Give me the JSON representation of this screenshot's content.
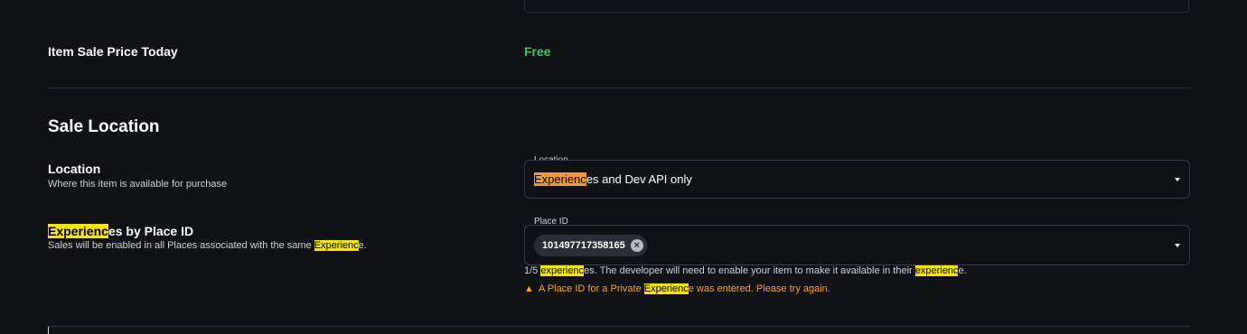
{
  "price": {
    "label": "Item Sale Price Today",
    "value": "Free"
  },
  "sale_location": {
    "title": "Sale Location",
    "location": {
      "label": "Location",
      "description": "Where this item is available for purchase",
      "field_caption": "Location",
      "selected_highlight": "Experienc",
      "selected_rest": "es and Dev API only"
    },
    "place_id": {
      "label_highlight": "Experienc",
      "label_rest": "es by Place ID",
      "description_pre": "Sales will be enabled in all Places associated with the same ",
      "description_highlight": "Experienc",
      "description_post": "e.",
      "field_caption": "Place ID",
      "chip_value": "101497717358165",
      "chip_close_icon": "×",
      "helper_pre": "1/5 ",
      "helper_hl1": "experienc",
      "helper_mid": "es. The developer will need to enable your item to make it available in their ",
      "helper_hl2": "experienc",
      "helper_post": "e.",
      "warning_icon": "▲",
      "warning_pre": "A Place ID for a Private ",
      "warning_highlight": "Experienc",
      "warning_post": "e was entered. Please try again."
    }
  },
  "colors": {
    "background": "#111216",
    "free_green": "#3ec46d",
    "warning": "#f5a623",
    "search_highlight": "#f4e409",
    "active_highlight": "#f59a2f"
  }
}
